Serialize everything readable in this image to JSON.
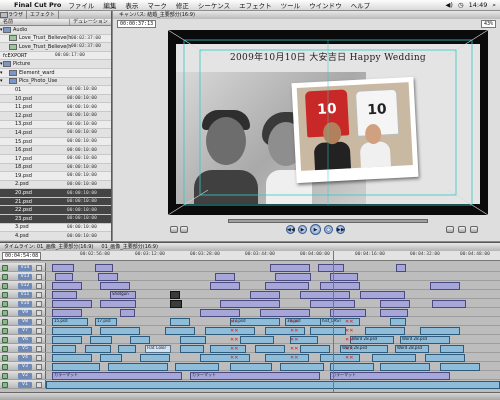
{
  "menubar": {
    "app": "Final Cut Pro",
    "items": [
      "ファイル",
      "編集",
      "表示",
      "マーク",
      "修正",
      "シーケンス",
      "エフェクト",
      "ツール",
      "ウインドウ",
      "ヘルプ"
    ],
    "clock": "14:49"
  },
  "browser": {
    "tabs": [
      "ブラウザ",
      "エフェクト"
    ],
    "col_name": "名前",
    "col_duration": "デュレーション",
    "rows": [
      {
        "name": "Audio",
        "dur": "",
        "type": "bin",
        "indent": 0
      },
      {
        "name": "Love_Trust_Believe(history edit)",
        "dur": "00:02:37:00",
        "type": "aud",
        "indent": 1
      },
      {
        "name": "Love_Trust_Believe(history edit)",
        "dur": "00:02:37:00",
        "type": "aud",
        "indent": 1
      },
      {
        "name": "fcEXPORT",
        "dur": "00:00:17:00",
        "type": "clip",
        "indent": 0
      },
      {
        "name": "Picture",
        "dur": "",
        "type": "bin",
        "indent": 0
      },
      {
        "name": "Element_ward",
        "dur": "",
        "type": "bin",
        "indent": 1
      },
      {
        "name": "Pics_Photo_Use",
        "dur": "",
        "type": "bin",
        "indent": 1
      },
      {
        "name": "01",
        "dur": "00:00:10:00",
        "type": "clip",
        "indent": 2
      },
      {
        "name": "10.psd",
        "dur": "00:00:10:00",
        "type": "clip",
        "indent": 2
      },
      {
        "name": "11.psd",
        "dur": "00:00:10:00",
        "type": "clip",
        "indent": 2
      },
      {
        "name": "12.psd",
        "dur": "00:00:10:00",
        "type": "clip",
        "indent": 2
      },
      {
        "name": "13.psd",
        "dur": "00:00:10:00",
        "type": "clip",
        "indent": 2
      },
      {
        "name": "14.psd",
        "dur": "00:00:10:00",
        "type": "clip",
        "indent": 2
      },
      {
        "name": "15.psd",
        "dur": "00:00:10:00",
        "type": "clip",
        "indent": 2
      },
      {
        "name": "16.psd",
        "dur": "00:00:10:00",
        "type": "clip",
        "indent": 2
      },
      {
        "name": "17.psd",
        "dur": "00:00:10:00",
        "type": "clip",
        "indent": 2
      },
      {
        "name": "18.psd",
        "dur": "00:00:10:00",
        "type": "clip",
        "indent": 2
      },
      {
        "name": "19.psd",
        "dur": "00:00:10:00",
        "type": "clip",
        "indent": 2
      },
      {
        "name": "2.psd",
        "dur": "00:00:10:00",
        "type": "clip",
        "indent": 2
      },
      {
        "name": "20.psd",
        "dur": "00:00:10:00",
        "type": "clip",
        "indent": 2,
        "sel": true
      },
      {
        "name": "21.psd",
        "dur": "00:00:10:00",
        "type": "clip",
        "indent": 2,
        "sel": true
      },
      {
        "name": "22.psd",
        "dur": "00:00:10:00",
        "type": "clip",
        "indent": 2,
        "sel": true
      },
      {
        "name": "23.psd",
        "dur": "00:00:10:00",
        "type": "clip",
        "indent": 2,
        "sel": true
      },
      {
        "name": "3.psd",
        "dur": "00:00:10:00",
        "type": "clip",
        "indent": 2
      },
      {
        "name": "4.psd",
        "dur": "00:00:10:00",
        "type": "clip",
        "indent": 2
      },
      {
        "name": "5.psd",
        "dur": "00:00:10:00",
        "type": "clip",
        "indent": 2
      },
      {
        "name": "6.psd",
        "dur": "00:00:10:00",
        "type": "clip",
        "indent": 2
      }
    ]
  },
  "canvas": {
    "tab": "キャンバス: 結婚_主要部分(16:9)",
    "timecode": "00:00:37:13",
    "zoom": "43%",
    "title_overlay": "2009年10月10日 大安吉日  Happy Wedding",
    "jersey_numbers": [
      "10",
      "10"
    ]
  },
  "timeline": {
    "tabs": [
      "タイムライン: 01_画像_主要部分(16:9)",
      "01_画像_主要部分(16:9)"
    ],
    "timecode": "00:04:54:08",
    "ruler_labels": [
      "00:02:56:00",
      "00:03:12:00",
      "00:03:28:00",
      "00:03:44:00",
      "00:04:00:00",
      "00:04:16:00",
      "00:04:32:00",
      "00:04:48:00"
    ],
    "video_tracks": [
      "V14",
      "V13",
      "V12",
      "V11",
      "V10",
      "V9",
      "V8",
      "V7",
      "V6",
      "V5",
      "V4",
      "V3",
      "V2",
      "V1"
    ],
    "audio_tracks": [
      "A1",
      "A2"
    ],
    "clip_labels": {
      "shotgun": "Shotgun",
      "psd17": "17.psd",
      "psd15": "15.psd",
      "psd37": "37.psd",
      "psd38": "38.psd",
      "word": "Word 28.psd",
      "histlast": "hist_LAST",
      "flatcolor": "Flat Color",
      "colormatte": "カラーマット",
      "audio": "Love_Trust_Believe(history edit).aif"
    }
  }
}
